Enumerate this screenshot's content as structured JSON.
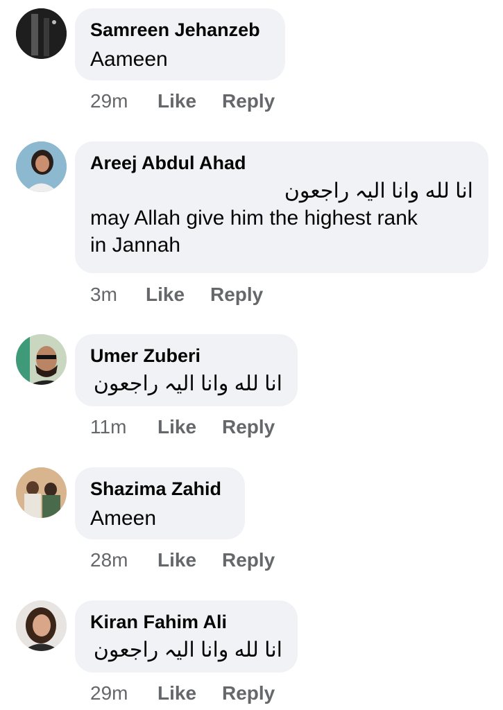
{
  "comments": [
    {
      "author": "Samreen Jehanzeb",
      "lines": [
        "Aameen"
      ],
      "time": "29m",
      "like": "Like",
      "reply": "Reply"
    },
    {
      "author": "Areej Abdul Ahad",
      "lines": [
        "انا لله وانا الیہ راجعون",
        "may Allah give him the highest rank",
        "in Jannah"
      ],
      "time": "3m",
      "like": "Like",
      "reply": "Reply"
    },
    {
      "author": "Umer Zuberi",
      "lines": [
        "انا لله وانا الیہ راجعون"
      ],
      "time": "11m",
      "like": "Like",
      "reply": "Reply"
    },
    {
      "author": "Shazima Zahid",
      "lines": [
        "Ameen"
      ],
      "time": "28m",
      "like": "Like",
      "reply": "Reply"
    },
    {
      "author": "Kiran Fahim Ali",
      "lines": [
        "انا لله وانا الیہ راجعون"
      ],
      "time": "29m",
      "like": "Like",
      "reply": "Reply"
    }
  ]
}
